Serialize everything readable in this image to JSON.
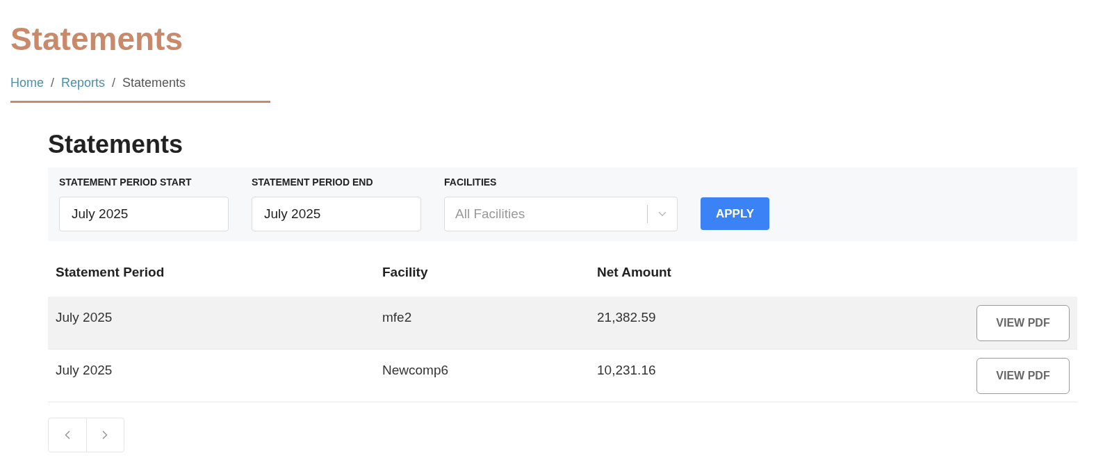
{
  "page_title": "Statements",
  "breadcrumb": [
    {
      "label": "Home",
      "link": true
    },
    {
      "separator": "/",
      "label": "Reports",
      "link": true
    },
    {
      "separator": "/",
      "label": "Statements",
      "link": false
    }
  ],
  "section_title": "Statements",
  "filters": [
    {
      "kind": "text",
      "label": "STATEMENT PERIOD START",
      "value": "July 2025"
    },
    {
      "kind": "text",
      "label": "STATEMENT PERIOD END",
      "value": "July 2025"
    },
    {
      "kind": "select",
      "label": "FACILITIES",
      "placeholder": "All Facilities"
    }
  ],
  "apply_button": "APPLY",
  "table": {
    "columns": [
      "Statement Period",
      "Facility",
      "Net Amount"
    ],
    "rows": [
      {
        "cells": [
          "July 2025",
          "mfe2",
          "21,382.59"
        ],
        "action": "VIEW PDF",
        "hovered": true
      },
      {
        "cells": [
          "July 2025",
          "Newcomp6",
          "10,231.16"
        ],
        "action": "VIEW PDF",
        "hovered": false
      }
    ]
  }
}
